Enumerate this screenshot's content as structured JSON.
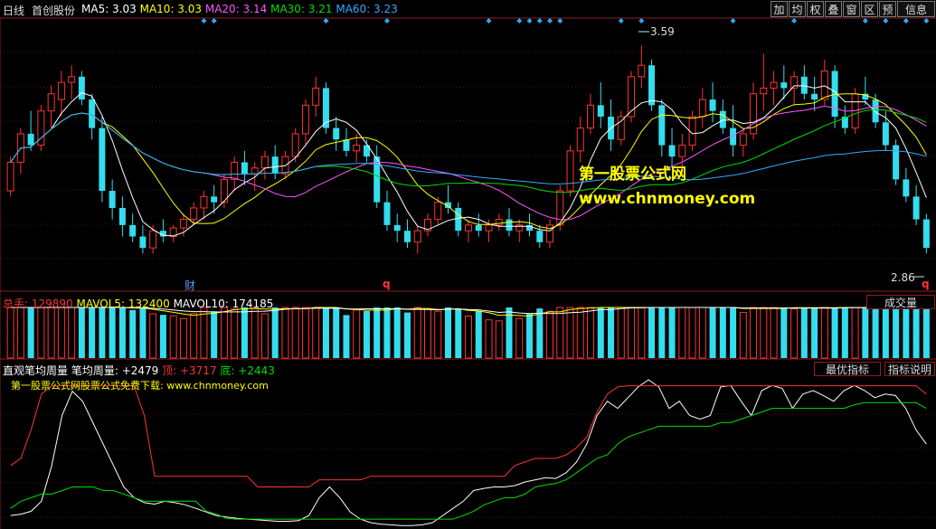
{
  "header": {
    "period_label": "日线",
    "stock_name": "首创股份",
    "ma_items": [
      {
        "label": "MA5: 3.03",
        "color": "#ffffff"
      },
      {
        "label": "MA10: 3.03",
        "color": "#ffff00"
      },
      {
        "label": "MA20: 3.14",
        "color": "#ff55ff"
      },
      {
        "label": "MA30: 3.21",
        "color": "#00dd00"
      },
      {
        "label": "MA60: 3.23",
        "color": "#33aaff"
      }
    ]
  },
  "toolbar": {
    "buttons": [
      "加",
      "均",
      "权",
      "叠",
      "窗",
      "区",
      "预",
      "信息"
    ]
  },
  "price_panel": {
    "high_label": "3.59",
    "low_label": "2.86",
    "marker_cai": "财",
    "marker_q1": "q",
    "marker_q2": "q"
  },
  "watermark": {
    "title": "第一股票公式网",
    "url": "www.chnmoney.com"
  },
  "volume_panel": {
    "items": [
      {
        "label": "总手: 129890",
        "color": "#ff3333"
      },
      {
        "label": "MAVOL5: 132400",
        "color": "#ffff00"
      },
      {
        "label": "MAVOL10: 174185",
        "color": "#ffffff"
      }
    ],
    "button_label": "成交量"
  },
  "indicator_panel": {
    "title": "直观笔均周量",
    "items": [
      {
        "label": "笔均周量: +2479",
        "color": "#ffffff"
      },
      {
        "label": "顶: +3717",
        "color": "#ff3333"
      },
      {
        "label": "底: +2443",
        "color": "#00dd00"
      }
    ],
    "subtitle": "第一股票公式网股票公式免费下载: www.chnmoney.com",
    "button_best": "最优指标",
    "button_info": "指标说明"
  },
  "chart_data": {
    "type": "candlestick",
    "ylim": [
      2.76,
      3.66
    ],
    "candles": [
      [
        3.08,
        3.2,
        3.06,
        3.18
      ],
      [
        3.18,
        3.3,
        3.14,
        3.28
      ],
      [
        3.28,
        3.36,
        3.22,
        3.24
      ],
      [
        3.24,
        3.38,
        3.22,
        3.36
      ],
      [
        3.36,
        3.45,
        3.3,
        3.42
      ],
      [
        3.4,
        3.5,
        3.34,
        3.46
      ],
      [
        3.46,
        3.52,
        3.4,
        3.48
      ],
      [
        3.48,
        3.5,
        3.38,
        3.4
      ],
      [
        3.4,
        3.42,
        3.26,
        3.3
      ],
      [
        3.3,
        3.34,
        3.04,
        3.08
      ],
      [
        3.08,
        3.12,
        2.98,
        3.02
      ],
      [
        3.02,
        3.06,
        2.92,
        2.96
      ],
      [
        2.96,
        3.0,
        2.9,
        2.92
      ],
      [
        2.92,
        2.96,
        2.86,
        2.88
      ],
      [
        2.88,
        2.96,
        2.86,
        2.94
      ],
      [
        2.94,
        2.98,
        2.9,
        2.92
      ],
      [
        2.92,
        2.96,
        2.9,
        2.95
      ],
      [
        2.95,
        3.0,
        2.92,
        2.98
      ],
      [
        2.98,
        3.04,
        2.96,
        3.02
      ],
      [
        3.02,
        3.08,
        2.98,
        3.06
      ],
      [
        3.06,
        3.1,
        3.0,
        3.04
      ],
      [
        3.04,
        3.14,
        3.02,
        3.12
      ],
      [
        3.12,
        3.2,
        3.08,
        3.18
      ],
      [
        3.18,
        3.22,
        3.1,
        3.14
      ],
      [
        3.14,
        3.18,
        3.08,
        3.16
      ],
      [
        3.16,
        3.22,
        3.12,
        3.2
      ],
      [
        3.2,
        3.24,
        3.12,
        3.14
      ],
      [
        3.14,
        3.22,
        3.12,
        3.2
      ],
      [
        3.2,
        3.3,
        3.18,
        3.28
      ],
      [
        3.28,
        3.4,
        3.24,
        3.38
      ],
      [
        3.38,
        3.48,
        3.34,
        3.44
      ],
      [
        3.44,
        3.46,
        3.28,
        3.3
      ],
      [
        3.3,
        3.34,
        3.22,
        3.26
      ],
      [
        3.26,
        3.3,
        3.2,
        3.22
      ],
      [
        3.22,
        3.28,
        3.18,
        3.24
      ],
      [
        3.24,
        3.26,
        3.18,
        3.2
      ],
      [
        3.2,
        3.24,
        3.02,
        3.04
      ],
      [
        3.04,
        3.08,
        2.94,
        2.96
      ],
      [
        2.96,
        3.0,
        2.9,
        2.94
      ],
      [
        2.94,
        2.98,
        2.88,
        2.9
      ],
      [
        2.9,
        2.96,
        2.86,
        2.94
      ],
      [
        2.94,
        3.0,
        2.92,
        2.98
      ],
      [
        2.98,
        3.06,
        2.96,
        3.04
      ],
      [
        3.04,
        3.1,
        3.0,
        3.02
      ],
      [
        3.02,
        3.04,
        2.92,
        2.94
      ],
      [
        2.94,
        2.98,
        2.9,
        2.96
      ],
      [
        2.96,
        3.0,
        2.92,
        2.94
      ],
      [
        2.94,
        2.98,
        2.9,
        2.96
      ],
      [
        2.96,
        3.0,
        2.94,
        2.98
      ],
      [
        2.98,
        3.02,
        2.92,
        2.94
      ],
      [
        2.94,
        2.98,
        2.9,
        2.96
      ],
      [
        2.96,
        3.0,
        2.92,
        2.94
      ],
      [
        2.94,
        2.96,
        2.88,
        2.9
      ],
      [
        2.9,
        2.98,
        2.88,
        2.96
      ],
      [
        2.96,
        3.1,
        2.94,
        3.08
      ],
      [
        3.08,
        3.24,
        3.06,
        3.22
      ],
      [
        3.22,
        3.34,
        3.18,
        3.3
      ],
      [
        3.3,
        3.42,
        3.28,
        3.38
      ],
      [
        3.38,
        3.46,
        3.3,
        3.34
      ],
      [
        3.34,
        3.4,
        3.22,
        3.26
      ],
      [
        3.26,
        3.36,
        3.24,
        3.34
      ],
      [
        3.34,
        3.5,
        3.32,
        3.48
      ],
      [
        3.48,
        3.59,
        3.44,
        3.52
      ],
      [
        3.52,
        3.54,
        3.36,
        3.38
      ],
      [
        3.38,
        3.4,
        3.2,
        3.24
      ],
      [
        3.24,
        3.3,
        3.16,
        3.2
      ],
      [
        3.2,
        3.28,
        3.14,
        3.24
      ],
      [
        3.24,
        3.36,
        3.22,
        3.34
      ],
      [
        3.34,
        3.44,
        3.3,
        3.4
      ],
      [
        3.4,
        3.46,
        3.32,
        3.36
      ],
      [
        3.36,
        3.4,
        3.28,
        3.3
      ],
      [
        3.3,
        3.38,
        3.2,
        3.24
      ],
      [
        3.24,
        3.3,
        3.2,
        3.28
      ],
      [
        3.28,
        3.46,
        3.26,
        3.42
      ],
      [
        3.42,
        3.56,
        3.36,
        3.44
      ],
      [
        3.44,
        3.5,
        3.38,
        3.46
      ],
      [
        3.46,
        3.52,
        3.4,
        3.44
      ],
      [
        3.44,
        3.5,
        3.38,
        3.48
      ],
      [
        3.48,
        3.52,
        3.4,
        3.42
      ],
      [
        3.42,
        3.48,
        3.36,
        3.4
      ],
      [
        3.4,
        3.54,
        3.38,
        3.5
      ],
      [
        3.5,
        3.52,
        3.3,
        3.34
      ],
      [
        3.34,
        3.38,
        3.28,
        3.3
      ],
      [
        3.3,
        3.44,
        3.28,
        3.42
      ],
      [
        3.42,
        3.48,
        3.38,
        3.4
      ],
      [
        3.4,
        3.42,
        3.3,
        3.32
      ],
      [
        3.32,
        3.36,
        3.22,
        3.24
      ],
      [
        3.24,
        3.26,
        3.1,
        3.12
      ],
      [
        3.12,
        3.16,
        3.04,
        3.06
      ],
      [
        3.06,
        3.1,
        2.96,
        2.98
      ],
      [
        2.98,
        3.0,
        2.86,
        2.88
      ]
    ],
    "vol_label": "总手",
    "indicator_series": [
      {
        "name": "笔均周量",
        "color": "#ffffff",
        "values": [
          1900,
          1920,
          1960,
          2100,
          2600,
          3300,
          3640,
          3500,
          3200,
          2900,
          2600,
          2300,
          2150,
          2080,
          2060,
          2100,
          2080,
          2050,
          2000,
          1950,
          1900,
          1880,
          1860,
          1850,
          1840,
          1830,
          1820,
          1820,
          1830,
          1900,
          2150,
          2300,
          2150,
          1950,
          1850,
          1800,
          1780,
          1770,
          1760,
          1760,
          1770,
          1800,
          1900,
          2000,
          2100,
          2250,
          2280,
          2300,
          2300,
          2320,
          2370,
          2400,
          2430,
          2420,
          2500,
          2650,
          2900,
          3300,
          3500,
          3400,
          3550,
          3700,
          3800,
          3700,
          3400,
          3500,
          3300,
          3250,
          3300,
          3700,
          3720,
          3500,
          3300,
          3650,
          3720,
          3680,
          3400,
          3600,
          3650,
          3580,
          3500,
          3650,
          3720,
          3650,
          3550,
          3600,
          3580,
          3400,
          3100,
          2900
        ]
      },
      {
        "name": "顶",
        "color": "#ff3333",
        "values": [
          2600,
          2700,
          3100,
          3600,
          3717,
          3717,
          3717,
          3717,
          3717,
          3717,
          3717,
          3717,
          3717,
          3300,
          2450,
          2450,
          2450,
          2450,
          2450,
          2450,
          2450,
          2450,
          2450,
          2450,
          2300,
          2300,
          2300,
          2300,
          2300,
          2300,
          2400,
          2400,
          2400,
          2400,
          2400,
          2450,
          2450,
          2450,
          2450,
          2450,
          2450,
          2450,
          2450,
          2450,
          2450,
          2450,
          2450,
          2450,
          2450,
          2600,
          2650,
          2700,
          2700,
          2700,
          2750,
          2850,
          3000,
          3350,
          3600,
          3700,
          3717,
          3717,
          3717,
          3717,
          3717,
          3717,
          3717,
          3717,
          3717,
          3717,
          3717,
          3717,
          3717,
          3717,
          3717,
          3717,
          3717,
          3717,
          3717,
          3717,
          3717,
          3717,
          3717,
          3717,
          3717,
          3717,
          3717,
          3717,
          3717,
          3600
        ]
      },
      {
        "name": "底",
        "color": "#00dd00",
        "values": [
          2000,
          2100,
          2150,
          2200,
          2200,
          2250,
          2300,
          2300,
          2300,
          2250,
          2250,
          2200,
          2150,
          2100,
          2100,
          2100,
          2100,
          2100,
          2100,
          1960,
          1920,
          1860,
          1850,
          1850,
          1850,
          1850,
          1850,
          1850,
          1850,
          1850,
          1850,
          1850,
          1850,
          1850,
          1850,
          1850,
          1850,
          1850,
          1850,
          1850,
          1850,
          1850,
          1850,
          1850,
          1900,
          1960,
          2050,
          2100,
          2150,
          2150,
          2200,
          2300,
          2330,
          2350,
          2400,
          2500,
          2600,
          2700,
          2750,
          2900,
          3000,
          3050,
          3100,
          3150,
          3150,
          3150,
          3150,
          3150,
          3150,
          3200,
          3200,
          3250,
          3300,
          3350,
          3400,
          3400,
          3400,
          3400,
          3400,
          3400,
          3400,
          3400,
          3450,
          3480,
          3480,
          3480,
          3480,
          3480,
          3480,
          3400
        ]
      }
    ],
    "indicator_ylim": [
      1750,
      3800
    ]
  }
}
